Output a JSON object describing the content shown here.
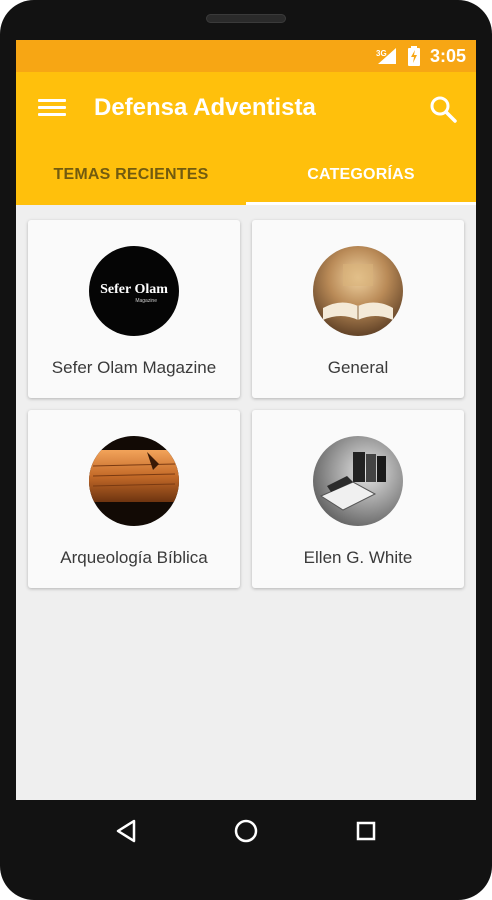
{
  "status_bar": {
    "network": "3G",
    "time": "3:05"
  },
  "app_bar": {
    "title": "Defensa Adventista",
    "menu_icon": "hamburger-menu-icon",
    "search_icon": "search-icon"
  },
  "tabs": [
    {
      "label": "TEMAS RECIENTES",
      "active": false
    },
    {
      "label": "CATEGORÍAS",
      "active": true
    }
  ],
  "categories": [
    {
      "label": "Sefer Olam Magazine",
      "logo_text": "Sefer Olam",
      "logo_sub": "Magazine"
    },
    {
      "label": "General"
    },
    {
      "label": "Arqueología Bíblica"
    },
    {
      "label": "Ellen G. White"
    }
  ],
  "colors": {
    "status_bar": "#f7a614",
    "app_bar": "#ffc00c",
    "background": "#efefef",
    "card": "#fafafa"
  },
  "nav_bar": {
    "back_icon": "back-triangle-icon",
    "home_icon": "home-circle-icon",
    "recents_icon": "recents-square-icon"
  }
}
